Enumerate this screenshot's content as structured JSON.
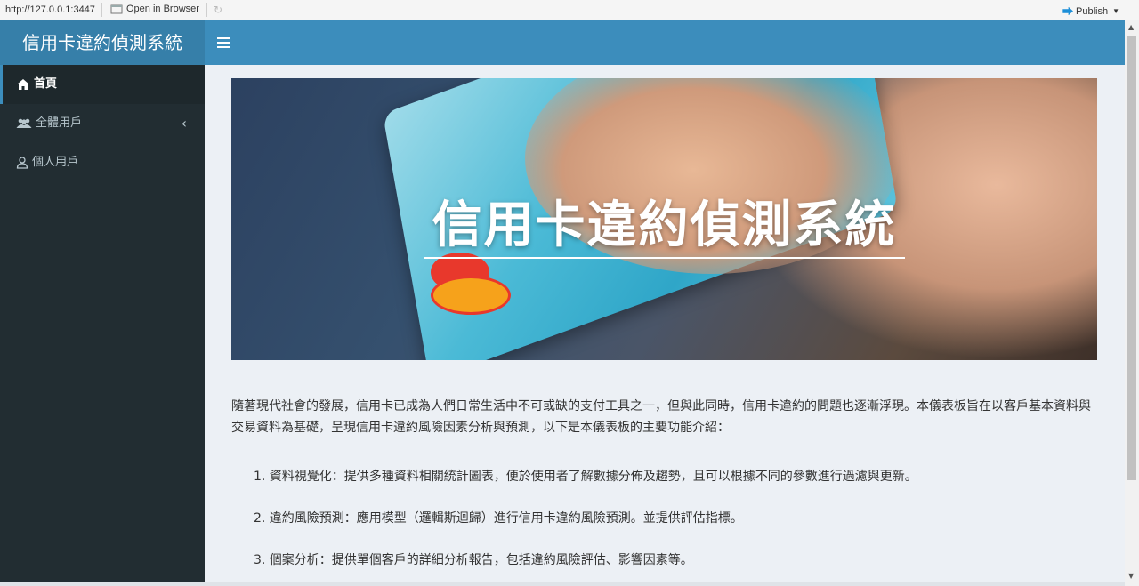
{
  "browser": {
    "url": "http://127.0.0.1:3447",
    "open_in_browser": "Open in Browser",
    "publish": "Publish",
    "icons": [
      "open-in-browser-icon",
      "refresh-icon",
      "publish-icon"
    ]
  },
  "header": {
    "logo_title": "信用卡違約偵測系統",
    "toggle_icon": "hamburger-icon"
  },
  "sidebar": {
    "items": [
      {
        "label": "首頁",
        "icon": "home-icon",
        "active": true
      },
      {
        "label": "全體用戶",
        "icon": "users-icon",
        "active": false,
        "expandable": true
      },
      {
        "label": "個人用戶",
        "icon": "user-icon",
        "active": false
      }
    ]
  },
  "main": {
    "hero_title": "信用卡違約偵測系統",
    "intro": "隨著現代社會的發展，信用卡已成為人們日常生活中不可或缺的支付工具之一，但與此同時，信用卡違約的問題也逐漸浮現。本儀表板旨在以客戶基本資料與交易資料為基礎，呈現信用卡違約風險因素分析與預測，以下是本儀表板的主要功能介紹：",
    "features": [
      "1. 資料視覺化：提供多種資料相關統計圖表，便於使用者了解數據分佈及趨勢，且可以根據不同的參數進行過濾與更新。",
      "2. 違約風險預測：應用模型（邏輯斯迴歸）進行信用卡違約風險預測。並提供評估指標。",
      "3. 個案分析：提供單個客戶的詳細分析報告，包括違約風險評估、影響因素等。"
    ]
  },
  "colors": {
    "logo_bg": "#367fa9",
    "navbar_bg": "#3c8dbc",
    "sidebar_bg": "#222d32",
    "content_bg": "#ecf0f5"
  }
}
